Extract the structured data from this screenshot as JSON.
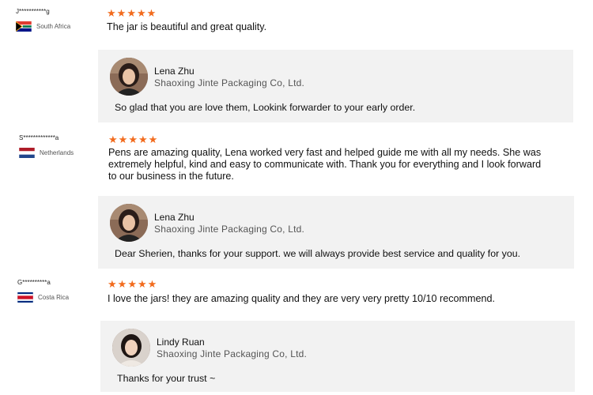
{
  "reviews": [
    {
      "reviewer": "J***********g",
      "country": "South Africa",
      "rating": 5,
      "text": "The jar is beautiful and great quality.",
      "reply": {
        "staff": "Lena Zhu",
        "company": "Shaoxing Jinte Packaging Co, Ltd.",
        "text": "So glad that you are love them, Lookink forwarder to your early order."
      }
    },
    {
      "reviewer": "S*************a",
      "country": "Netherlands",
      "rating": 5,
      "text_lines": [
        "Pens are amazing quality, Lena worked very fast and helped guide me with all my needs. She was",
        "extremely helpful, kind and easy to communicate with. Thank you for everything and I look forward",
        "to our business in the future."
      ],
      "reply": {
        "staff": "Lena Zhu",
        "company": "Shaoxing Jinte Packaging Co, Ltd.",
        "text": "Dear Sherien, thanks for your support. we will always provide best service and quality for you."
      }
    },
    {
      "reviewer": "G**********a",
      "country": "Costa Rica",
      "rating": 5,
      "text": "I love the jars! they are amazing quality and they are very very pretty 10/10 recommend.",
      "reply": {
        "staff": "Lindy Ruan",
        "company": "Shaoxing Jinte Packaging Co, Ltd.",
        "text": "Thanks for your trust ~"
      }
    }
  ],
  "colors": {
    "star": "#f26b1d",
    "reply_bg": "#f2f2f2"
  },
  "icons": {
    "star": "star-icon"
  }
}
